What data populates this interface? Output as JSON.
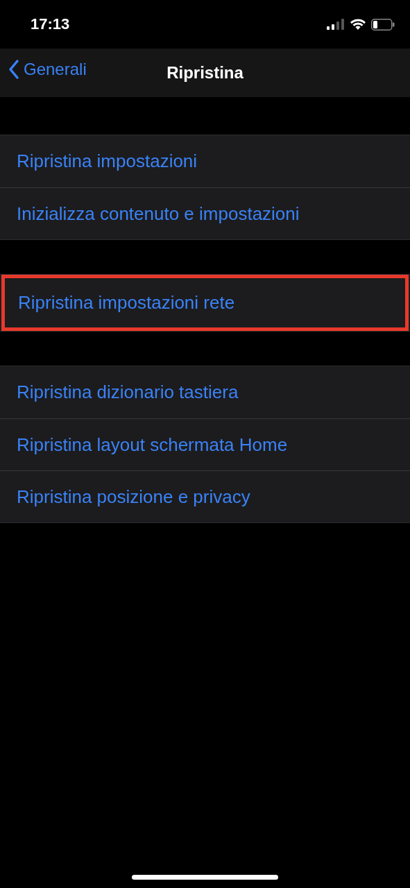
{
  "status_bar": {
    "time": "17:13"
  },
  "nav": {
    "back": "Generali",
    "title": "Ripristina"
  },
  "sections": [
    {
      "items": [
        {
          "label": "Ripristina impostazioni",
          "highlighted": false
        },
        {
          "label": "Inizializza contenuto e impostazioni",
          "highlighted": false
        }
      ]
    },
    {
      "items": [
        {
          "label": "Ripristina impostazioni rete",
          "highlighted": true
        }
      ]
    },
    {
      "items": [
        {
          "label": "Ripristina dizionario tastiera",
          "highlighted": false
        },
        {
          "label": "Ripristina layout schermata Home",
          "highlighted": false
        },
        {
          "label": "Ripristina posizione e privacy",
          "highlighted": false
        }
      ]
    }
  ]
}
